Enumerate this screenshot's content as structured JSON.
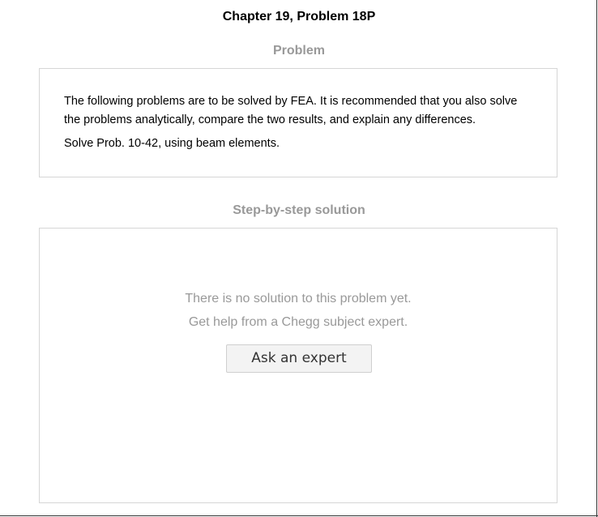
{
  "header": {
    "title": "Chapter 19, Problem 18P"
  },
  "problem": {
    "heading": "Problem",
    "text": "The following problems are to be solved by FEA. It is recommended that you also solve the problems analytically, compare the two results, and explain any differences.",
    "subtext": "Solve Prob. 10-42, using beam elements."
  },
  "solution": {
    "heading": "Step-by-step solution",
    "message_line1": "There is no solution to this problem yet.",
    "message_line2": "Get help from a Chegg subject expert.",
    "button_label": "Ask an expert"
  }
}
